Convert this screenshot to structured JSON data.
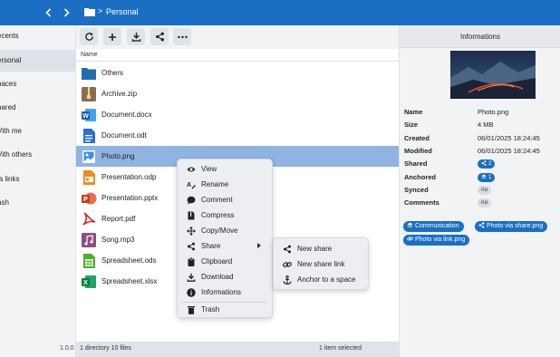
{
  "topbar": {
    "back_icon": "chevron-left-icon",
    "forward_icon": "chevron-right-icon",
    "breadcrumb_sep": ">",
    "breadcrumb": "Personal"
  },
  "sidebar": {
    "items": [
      {
        "label": "ecents"
      },
      {
        "label": "ersonal"
      },
      {
        "label": "paces"
      },
      {
        "label": "hared"
      },
      {
        "label": "Vith me"
      },
      {
        "label": "Vith others"
      },
      {
        "label": "ia links"
      },
      {
        "label": "ash"
      }
    ],
    "version": "1.0.0"
  },
  "toolbar": {
    "buttons": [
      "refresh-icon",
      "plus-icon",
      "download-icon",
      "share-icon",
      "more-icon"
    ]
  },
  "list": {
    "header": "Name",
    "files": [
      {
        "name": "Others",
        "type": "folder"
      },
      {
        "name": "Archive.zip",
        "type": "zip"
      },
      {
        "name": "Document.docx",
        "type": "docx"
      },
      {
        "name": "Document.odt",
        "type": "odt"
      },
      {
        "name": "Photo.png",
        "type": "png",
        "selected": true
      },
      {
        "name": "Presentation.odp",
        "type": "odp"
      },
      {
        "name": "Presentation.pptx",
        "type": "pptx"
      },
      {
        "name": "Report.pdf",
        "type": "pdf"
      },
      {
        "name": "Song.mp3",
        "type": "mp3"
      },
      {
        "name": "Spreadsheet.ods",
        "type": "ods"
      },
      {
        "name": "Spreadsheet.xlsx",
        "type": "xlsx"
      }
    ]
  },
  "status": {
    "left": "1 directory 10 files",
    "right": "1 item selected"
  },
  "panel": {
    "title": "Informations",
    "props": {
      "name_label": "Name",
      "name_value": "Photo.png",
      "size_label": "Size",
      "size_value": "4 MB",
      "created_label": "Created",
      "created_value": "06/01/2025 18:24:45",
      "modified_label": "Modified",
      "modified_value": "06/01/2025 18:24:45",
      "shared_label": "Shared",
      "shared_value": "2",
      "anchored_label": "Anchored",
      "anchored_value": "1",
      "synced_label": "Synced",
      "synced_value": "no",
      "comments_label": "Comments",
      "comments_value": "no"
    },
    "tags": [
      "Communication",
      "Photo via share.png",
      "Photo via link.png"
    ]
  },
  "context_menu": {
    "items": [
      "View",
      "Rename",
      "Comment",
      "Compress",
      "Copy/Move",
      "Share",
      "Clipboard",
      "Download",
      "Informations",
      "Trash"
    ]
  },
  "share_submenu": {
    "items": [
      "New share",
      "New share link",
      "Anchor to a space"
    ]
  },
  "colors": {
    "accent": "#1a6fc4",
    "selected_row": "#8fb4e0"
  }
}
